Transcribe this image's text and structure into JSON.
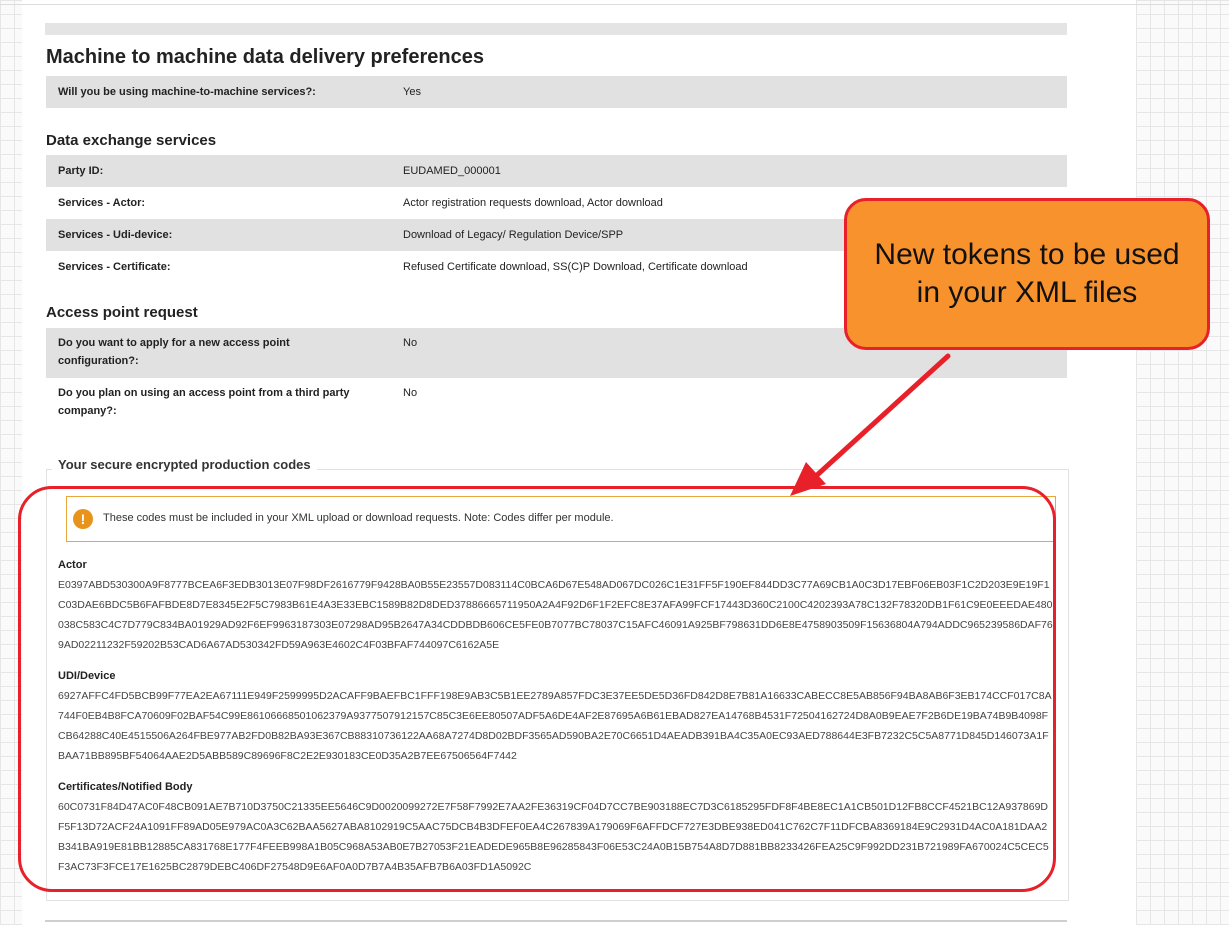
{
  "heading": "Machine to machine data delivery preferences",
  "m2m_row": {
    "label": "Will you be using machine-to-machine services?:",
    "value": "Yes"
  },
  "data_exchange": {
    "title": "Data exchange services",
    "rows": [
      {
        "label": "Party ID:",
        "value": "EUDAMED_000001"
      },
      {
        "label": "Services - Actor:",
        "value": "Actor registration requests download, Actor download"
      },
      {
        "label": "Services - Udi-device:",
        "value": "Download of Legacy/ Regulation Device/SPP"
      },
      {
        "label": "Services - Certificate:",
        "value": "Refused Certificate download, SS(C)P Download, Certificate download"
      }
    ]
  },
  "access_point": {
    "title": "Access point request",
    "rows": [
      {
        "label_line1": "Do you want to apply for a new access point",
        "label_line2": "configuration?:",
        "value": "No"
      },
      {
        "label_line1": "Do you plan on using an access point from a third party",
        "label_line2": "company?:",
        "value": "No"
      }
    ]
  },
  "codes": {
    "legend": "Your secure encrypted production codes",
    "warning": "These codes must be included in your XML upload or download requests. Note: Codes differ per module.",
    "warning_icon": "exclamation-icon",
    "blocks": [
      {
        "name": "Actor",
        "code": "E0397ABD530300A9F8777BCEA6F3EDB3013E07F98DF2616779F9428BA0B55E23557D083114C0BCA6D67E548AD067DC026C1E31FF5F190EF844DD3C77A69CB1A0C3D17EBF06EB03F1C2D203E9E19F1C03DAE6BDC5B6FAFBDE8D7E8345E2F5C7983B61E4A3E33EBC1589B82D8DED37886665711950A2A4F92D6F1F2EFC8E37AFA99FCF17443D360C2100C4202393A78C132F78320DB1F61C9E0EEEDAE480038C583C4C7D779C834BA01929AD92F6EF9963187303E07298AD95B2647A34CDDBDB606CE5FE0B7077BC78037C15AFC46091A925BF798631DD6E8E4758903509F15636804A794ADDC965239586DAF769AD02211232F59202B53CAD6A67AD530342FD59A963E4602C4F03BFAF744097C6162A5E"
      },
      {
        "name": "UDI/Device",
        "code": "6927AFFC4FD5BCB99F77EA2EA67111E949F2599995D2ACAFF9BAEFBC1FFF198E9AB3C5B1EE2789A857FDC3E37EE5DE5D36FD842D8E7B81A16633CABECC8E5AB856F94BA8AB6F3EB174CCF017C8A744F0EB4B8FCA70609F02BAF54C99E86106668501062379A9377507912157C85C3E6EE80507ADF5A6DE4AF2E87695A6B61EBAD827EA14768B4531F72504162724D8A0B9EAE7F2B6DE19BA74B9B4098FCB64288C40E4515506A264FBE977AB2FD0B82BA93E367CB88310736122AA68A7274D8D02BDF3565AD590BA2E70C6651D4AEADB391BA4C35A0EC93AED788644E3FB7232C5C5A8771D845D146073A1FBAA71BB895BF54064AAE2D5ABB589C89696F8C2E2E930183CE0D35A2B7EE67506564F7442"
      },
      {
        "name": "Certificates/Notified Body",
        "code": "60C0731F84D47AC0F48CB091AE7B710D3750C21335EE5646C9D0020099272E7F58F7992E7AA2FE36319CF04D7CC7BE903188EC7D3C6185295FDF8F4BE8EC1A1CB501D12FB8CCF4521BC12A937869DF5F13D72ACF24A1091FF89AD05E979AC0A3C62BAA5627ABA8102919C5AAC75DCB4B3DFEF0EA4C267839A179069F6AFFDCF727E3DBE938ED041C762C7F11DFCBA8369184E9C2931D4AC0A181DAA2B341BA919E81BB12885CA831768E177F4FEEB998A1B05C968A53AB0E7B27053F21EADEDE965B8E96285843F06E53C24A0B15B754A8D7D881BB8233426FEA25C9F992DD231B721989FA670024C5CEC5F3AC73F3FCE17E1625BC2879DEBC406DF27548D9E6AF0A0D7B7A4B35AFB7B6A03FD1A5092C"
      }
    ]
  },
  "callout": {
    "line1": "New tokens to be used",
    "line2": "in your XML files"
  },
  "annotation_colors": {
    "red": "#e8202a",
    "orange": "#f7922d"
  }
}
